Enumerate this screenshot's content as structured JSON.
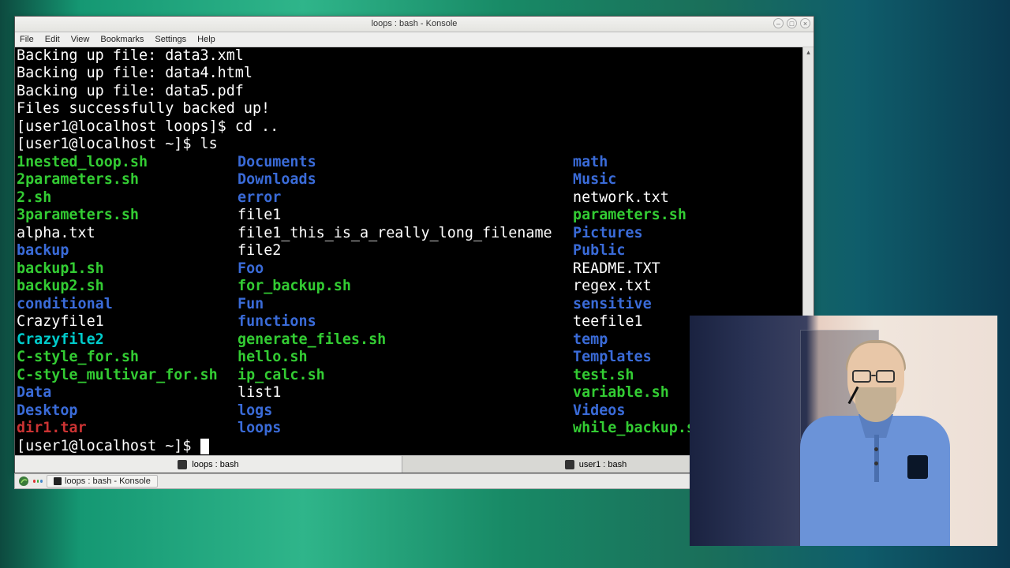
{
  "window": {
    "title": "loops : bash - Konsole",
    "controls": {
      "min": "–",
      "max": "□",
      "close": "×"
    }
  },
  "menu": {
    "file": "File",
    "edit": "Edit",
    "view": "View",
    "bookmarks": "Bookmarks",
    "settings": "Settings",
    "help": "Help"
  },
  "terminal": {
    "history": [
      "Backing up file: data3.xml",
      "Backing up file: data4.html",
      "Backing up file: data5.pdf",
      "Files successfully backed up!"
    ],
    "prompt1": "[user1@localhost loops]$ ",
    "cmd1": "cd ..",
    "prompt2": "[user1@localhost ~]$ ",
    "cmd2": "ls",
    "prompt3": "[user1@localhost ~]$ ",
    "ls": [
      {
        "c1": {
          "t": "1nested_loop.sh",
          "k": "exe"
        },
        "c2": {
          "t": "Documents",
          "k": "dir"
        },
        "c3": {
          "t": "math",
          "k": "dir"
        }
      },
      {
        "c1": {
          "t": "2parameters.sh",
          "k": "exe"
        },
        "c2": {
          "t": "Downloads",
          "k": "dir"
        },
        "c3": {
          "t": "Music",
          "k": "dir"
        }
      },
      {
        "c1": {
          "t": "2.sh",
          "k": "exe"
        },
        "c2": {
          "t": "error",
          "k": "dir"
        },
        "c3": {
          "t": "network.txt",
          "k": ""
        }
      },
      {
        "c1": {
          "t": "3parameters.sh",
          "k": "exe"
        },
        "c2": {
          "t": "file1",
          "k": ""
        },
        "c3": {
          "t": "parameters.sh",
          "k": "exe"
        }
      },
      {
        "c1": {
          "t": "alpha.txt",
          "k": ""
        },
        "c2": {
          "t": "file1_this_is_a_really_long_filename",
          "k": ""
        },
        "c3": {
          "t": "Pictures",
          "k": "dir"
        }
      },
      {
        "c1": {
          "t": "backup",
          "k": "dir"
        },
        "c2": {
          "t": "file2",
          "k": ""
        },
        "c3": {
          "t": "Public",
          "k": "dir"
        }
      },
      {
        "c1": {
          "t": "backup1.sh",
          "k": "exe"
        },
        "c2": {
          "t": "Foo",
          "k": "dir"
        },
        "c3": {
          "t": "README.TXT",
          "k": ""
        }
      },
      {
        "c1": {
          "t": "backup2.sh",
          "k": "exe"
        },
        "c2": {
          "t": "for_backup.sh",
          "k": "exe"
        },
        "c3": {
          "t": "regex.txt",
          "k": ""
        }
      },
      {
        "c1": {
          "t": "conditional",
          "k": "dir"
        },
        "c2": {
          "t": "Fun",
          "k": "dir"
        },
        "c3": {
          "t": "sensitive",
          "k": "dir"
        }
      },
      {
        "c1": {
          "t": "Crazyfile1",
          "k": ""
        },
        "c2": {
          "t": "functions",
          "k": "dir"
        },
        "c3": {
          "t": "teefile1",
          "k": ""
        }
      },
      {
        "c1": {
          "t": "Crazyfile2",
          "k": "sym"
        },
        "c2": {
          "t": "generate_files.sh",
          "k": "exe"
        },
        "c3": {
          "t": "temp",
          "k": "dir"
        }
      },
      {
        "c1": {
          "t": "C-style_for.sh",
          "k": "exe"
        },
        "c2": {
          "t": "hello.sh",
          "k": "exe"
        },
        "c3": {
          "t": "Templates",
          "k": "dir"
        }
      },
      {
        "c1": {
          "t": "C-style_multivar_for.sh",
          "k": "exe"
        },
        "c2": {
          "t": "ip_calc.sh",
          "k": "exe"
        },
        "c3": {
          "t": "test.sh",
          "k": "exe"
        }
      },
      {
        "c1": {
          "t": "Data",
          "k": "dir"
        },
        "c2": {
          "t": "list1",
          "k": ""
        },
        "c3": {
          "t": "variable.sh",
          "k": "exe"
        }
      },
      {
        "c1": {
          "t": "Desktop",
          "k": "dir"
        },
        "c2": {
          "t": "logs",
          "k": "dir"
        },
        "c3": {
          "t": "Videos",
          "k": "dir"
        }
      },
      {
        "c1": {
          "t": "dir1.tar",
          "k": "ar"
        },
        "c2": {
          "t": "loops",
          "k": "dir"
        },
        "c3": {
          "t": "while_backup.s",
          "k": "exe"
        }
      }
    ]
  },
  "tabs": {
    "tab1": "loops : bash",
    "tab2": "user1 : bash"
  },
  "taskbar": {
    "app": "loops : bash - Konsole"
  }
}
